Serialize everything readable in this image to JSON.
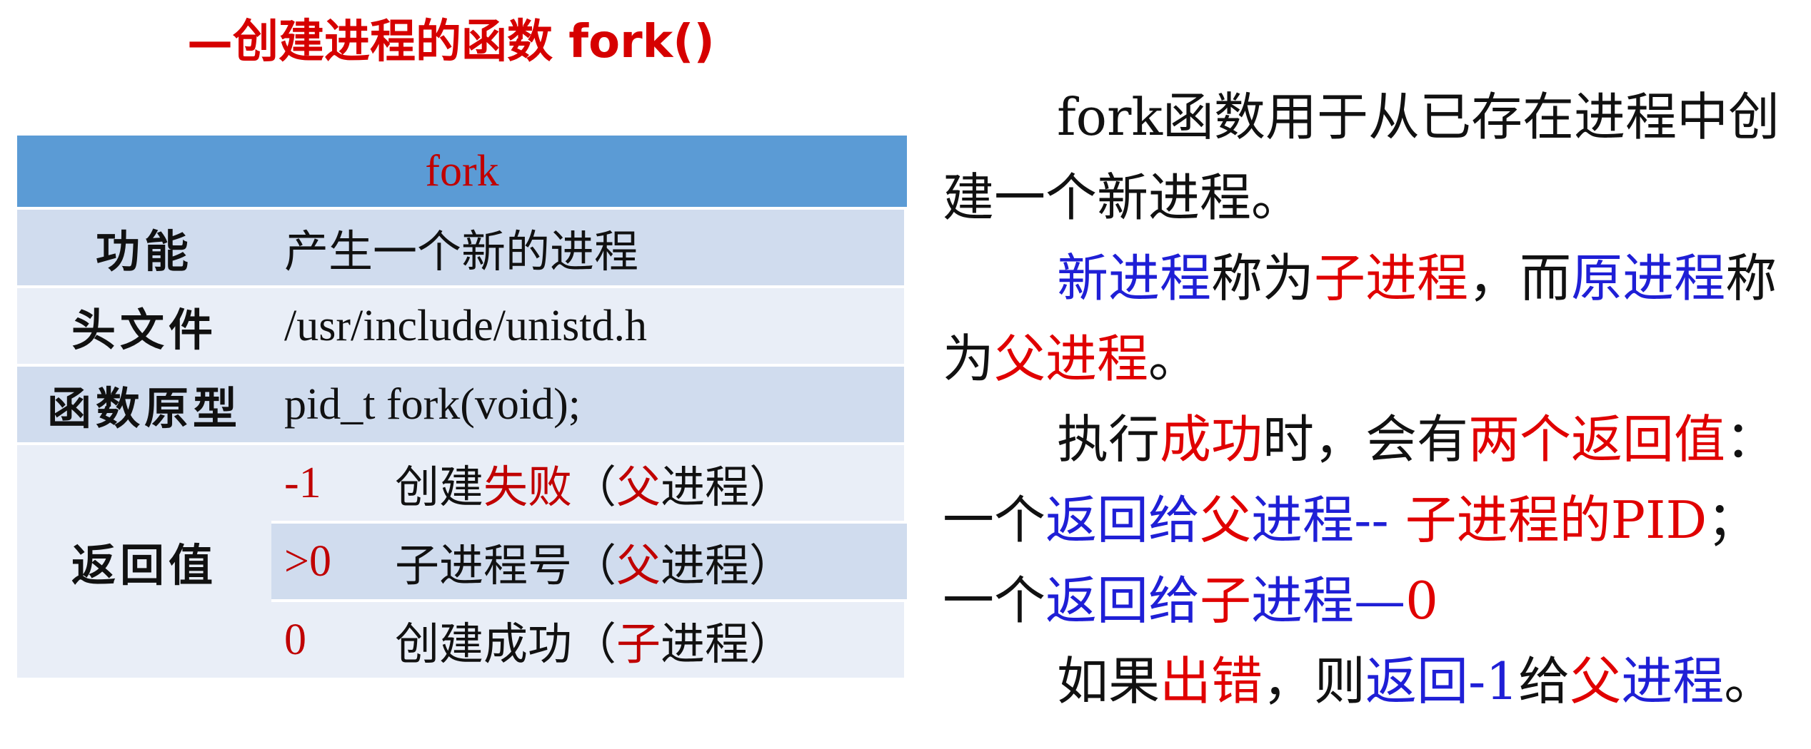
{
  "title": "—创建进程的函数 fork()",
  "table": {
    "header": "fork",
    "rows": [
      {
        "label": "功能",
        "value": "产生一个新的进程"
      },
      {
        "label": "头文件",
        "value": "/usr/include/unistd.h"
      },
      {
        "label": "函数原型",
        "value": "pid_t  fork(void);"
      }
    ],
    "return_label": "返回值",
    "returns": [
      {
        "code": "-1",
        "pre": "创建",
        "hl": "失败",
        "p1": "（",
        "who": "父",
        "p2": "进程）"
      },
      {
        "code": ">0",
        "pre": "子进程号",
        "hl": "",
        "p1": "（",
        "who": "父",
        "p2": "进程）"
      },
      {
        "code": "0",
        "pre": "创建成功",
        "hl": "",
        "p1": "（",
        "who": "子",
        "p2": "进程）"
      }
    ]
  },
  "description": {
    "p1": "fork函数用于从已存在进程中创建一个新进程。",
    "p2": {
      "a": "新进程",
      "b": "称为",
      "c": "子进程",
      "d": "，而",
      "e": "原进程",
      "f": "称为",
      "g": "父进程",
      "h": "。"
    },
    "p3": {
      "a": "执行",
      "b": "成功",
      "c": "时，会有",
      "d": "两个返回值",
      "e": "："
    },
    "p4": {
      "a": "一个",
      "b": "返回给",
      "c": "父",
      "d": "进程",
      "e": "-- ",
      "f": "子进程的PID",
      "g": "；"
    },
    "p5": {
      "a": "一个",
      "b": "返回给",
      "c": "子",
      "d": "进程",
      "e": "—",
      "f": "0"
    },
    "p6": {
      "a": "如果",
      "b": "出错",
      "c": "，则",
      "d": "返回-1",
      "e": "给",
      "f": "父",
      "g": "进程",
      "h": "。"
    }
  },
  "colors": {
    "title": "#d60000",
    "header": "#5b9bd5",
    "row_dark": "#d0dcee",
    "row_light": "#e9eef7",
    "red": "#c00000",
    "blue": "#1f1fd6"
  }
}
